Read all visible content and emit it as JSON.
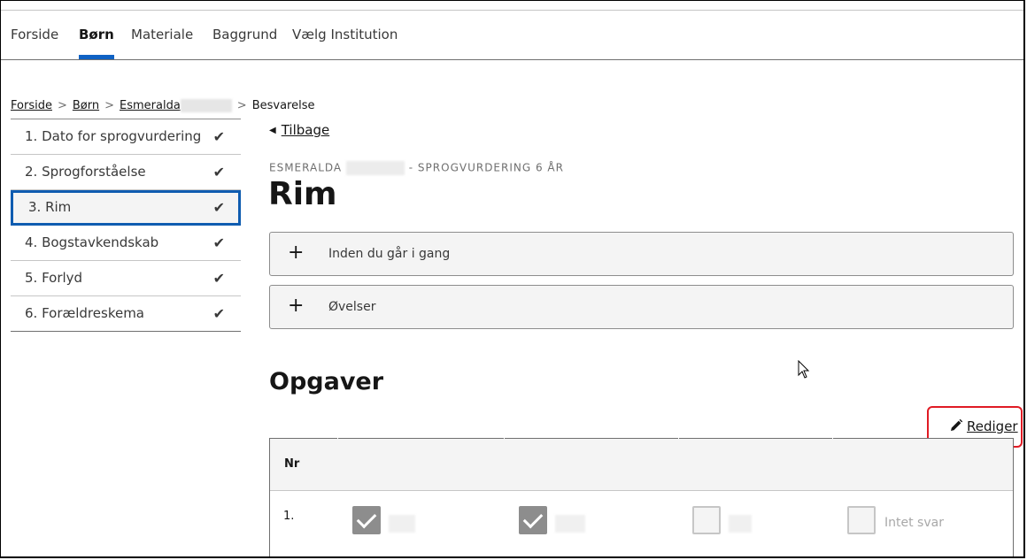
{
  "nav": {
    "items": [
      {
        "label": "Forside",
        "active": false
      },
      {
        "label": "Børn",
        "active": true
      },
      {
        "label": "Materiale",
        "active": false
      },
      {
        "label": "Baggrund",
        "active": false
      },
      {
        "label": "Vælg Institution",
        "active": false
      }
    ]
  },
  "breadcrumb": {
    "items": [
      "Forside",
      "Børn",
      "Esmeralda"
    ],
    "current": "Besvarelse",
    "separator": ">"
  },
  "steps": [
    {
      "label": "1. Dato for sprogvurdering",
      "completed": true
    },
    {
      "label": "2. Sprogforståelse",
      "completed": true
    },
    {
      "label": "3. Rim",
      "completed": true,
      "active": true
    },
    {
      "label": "4. Bogstavkendskab",
      "completed": true
    },
    {
      "label": "5. Forlyd",
      "completed": true
    },
    {
      "label": "6. Forældreskema",
      "completed": true
    }
  ],
  "icons": {
    "check": "✔",
    "back": "◀",
    "plus": "+",
    "pencil": "✎"
  },
  "back_label": "Tilbage",
  "eyebrow": {
    "name": "ESMERALDA",
    "suffix": "- SPROGVURDERING 6 ÅR"
  },
  "title": "Rim",
  "accordions": [
    {
      "label": "Inden du går i gang"
    },
    {
      "label": "Øvelser"
    }
  ],
  "section_title": "Opgaver",
  "edit_label": "Rediger",
  "table": {
    "header_nr": "Nr",
    "rows": [
      {
        "nr": "1.",
        "options": [
          {
            "checked": true,
            "label": ""
          },
          {
            "checked": true,
            "label": ""
          },
          {
            "checked": false,
            "label": ""
          },
          {
            "checked": false,
            "label": "Intet svar"
          }
        ]
      }
    ]
  },
  "colors": {
    "accent": "#0f62c4",
    "highlight": "#e01b24",
    "checkbox_checked": "#8d8d8d"
  }
}
